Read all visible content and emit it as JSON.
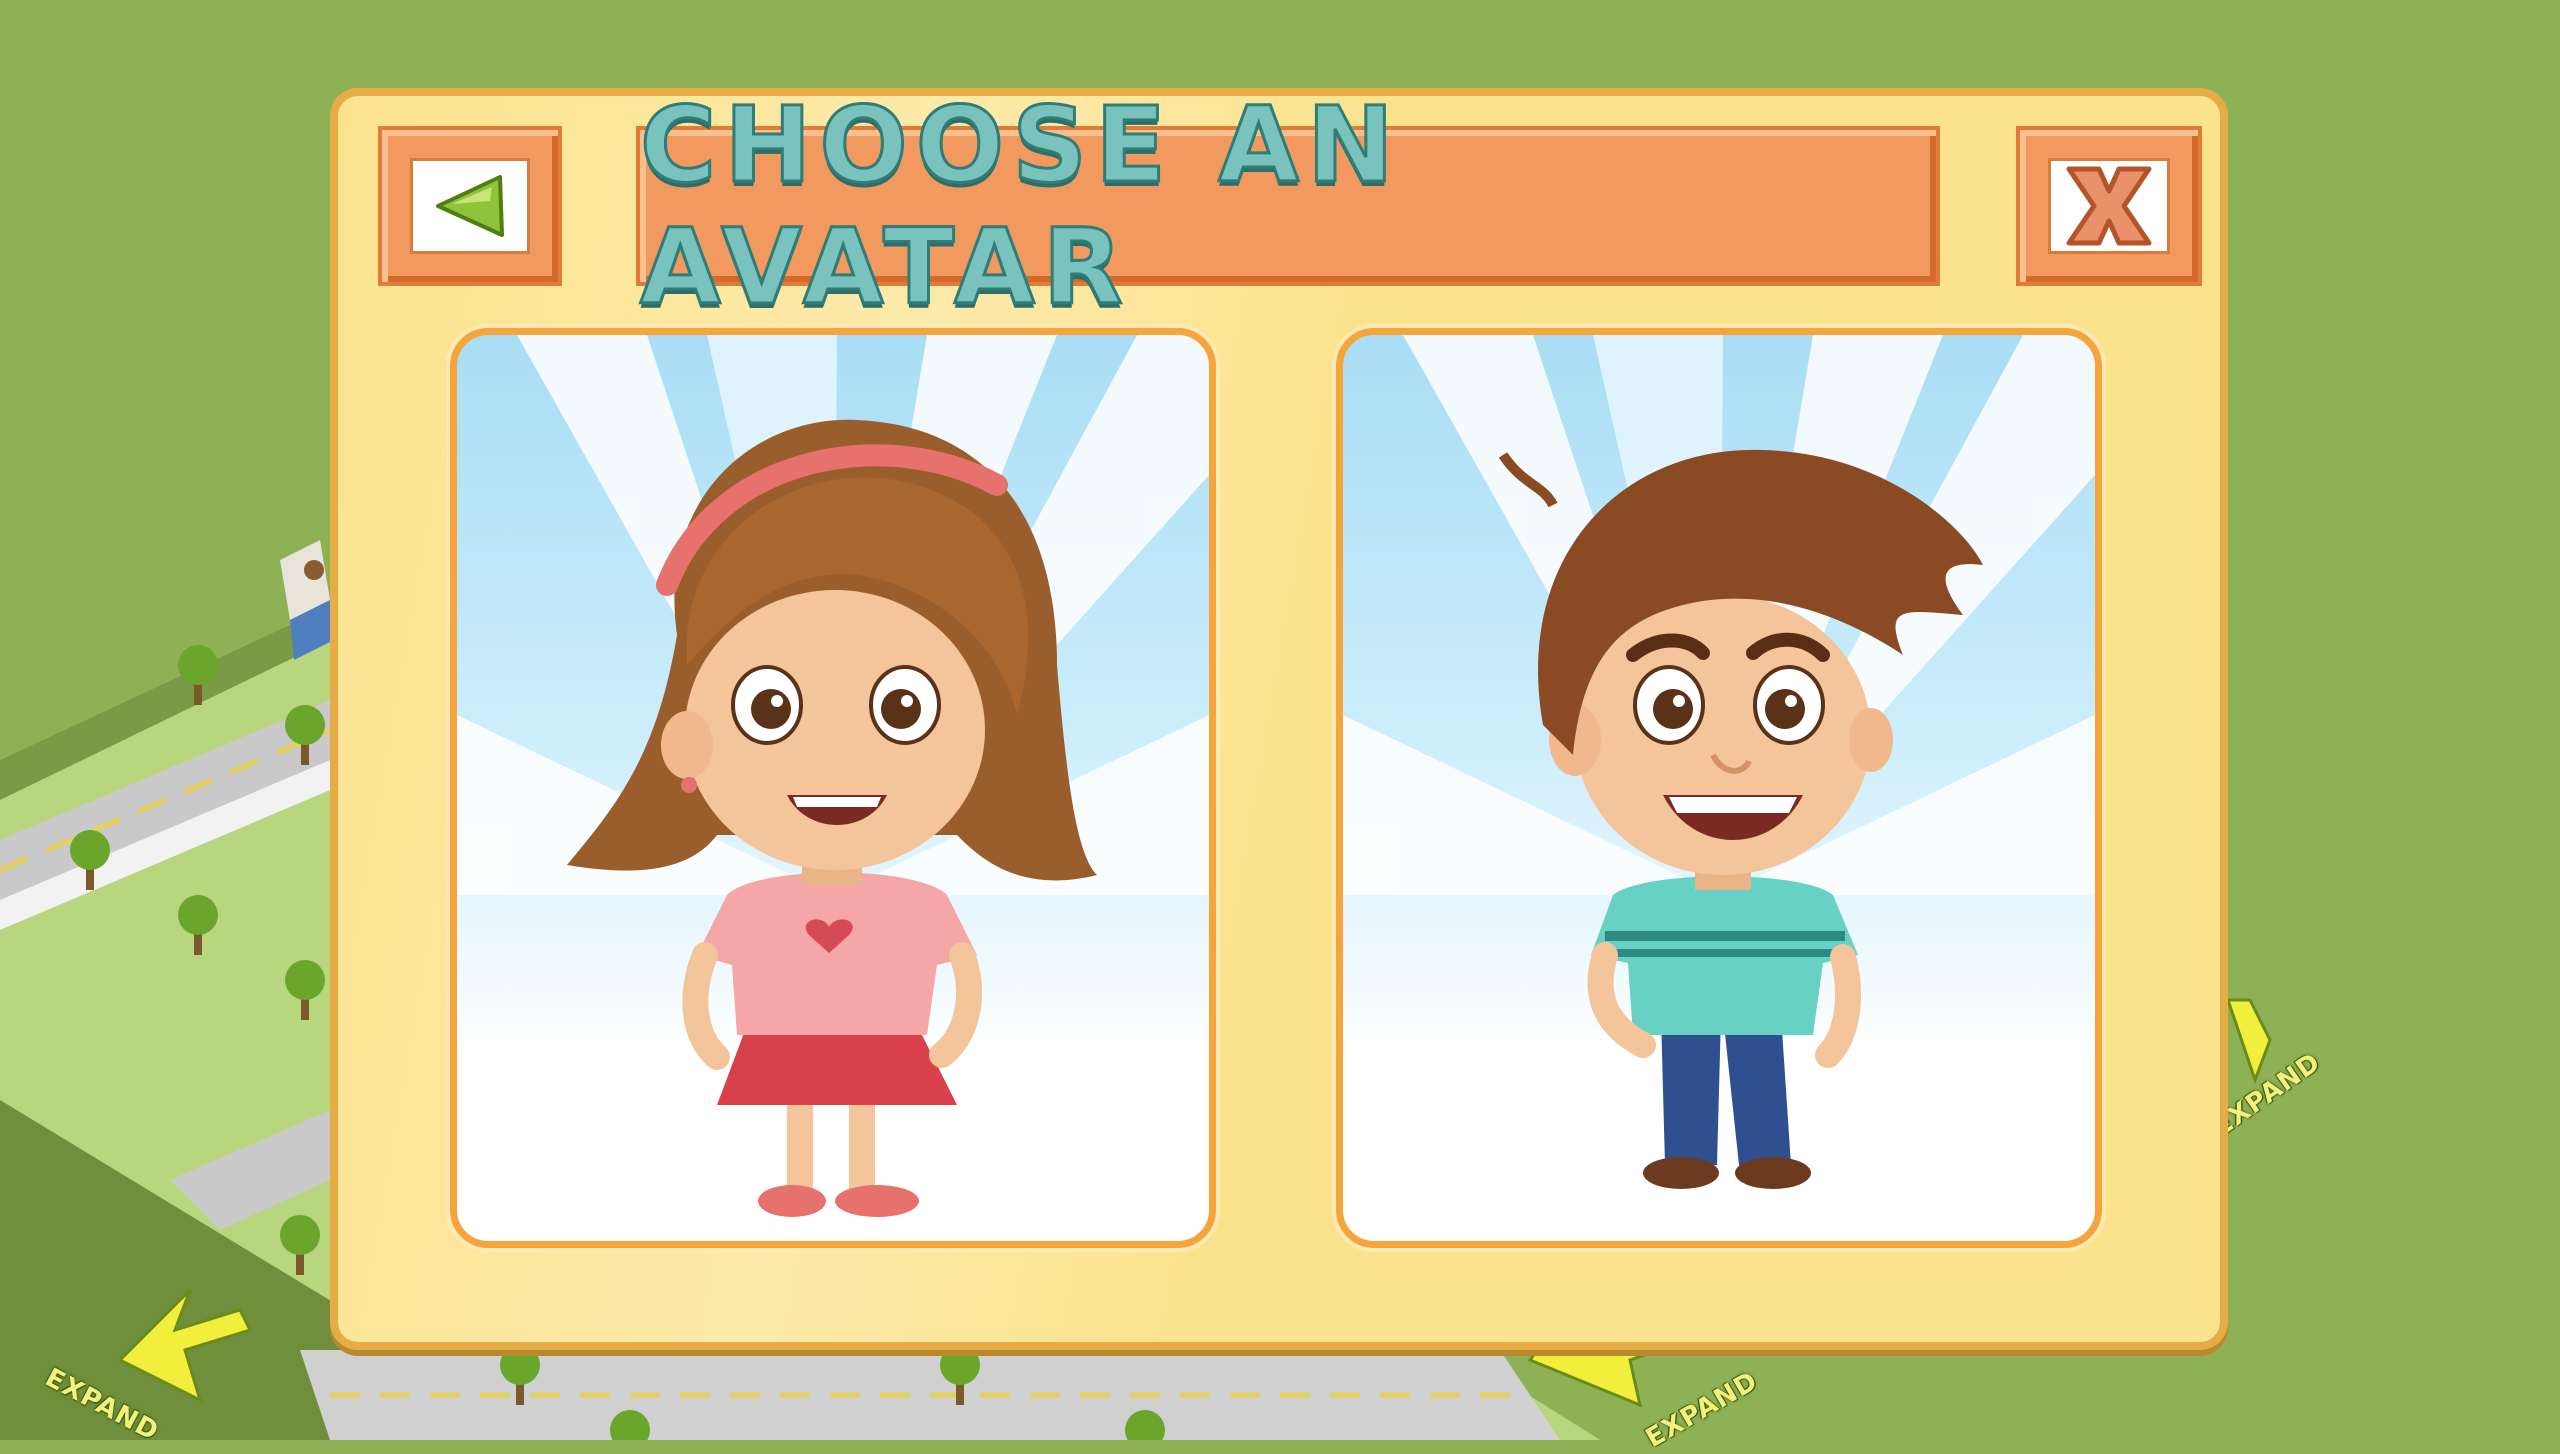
{
  "dialog": {
    "title": "CHOOSE AN AVATAR",
    "back_icon": "back-arrow-icon",
    "close_icon": "close-x-icon"
  },
  "avatars": [
    {
      "name": "girl",
      "icon": "girl-avatar"
    },
    {
      "name": "boy",
      "icon": "boy-avatar"
    }
  ],
  "background": {
    "expand_labels": [
      "EXPAND",
      "EXPAND",
      "EXPAND"
    ]
  },
  "colors": {
    "panel": "#fbe38e",
    "panel_border": "#e6ad47",
    "tile": "#f2995f",
    "title_text": "#79c2bd",
    "card_border": "#f6a53d",
    "grass": "#8fb155"
  }
}
